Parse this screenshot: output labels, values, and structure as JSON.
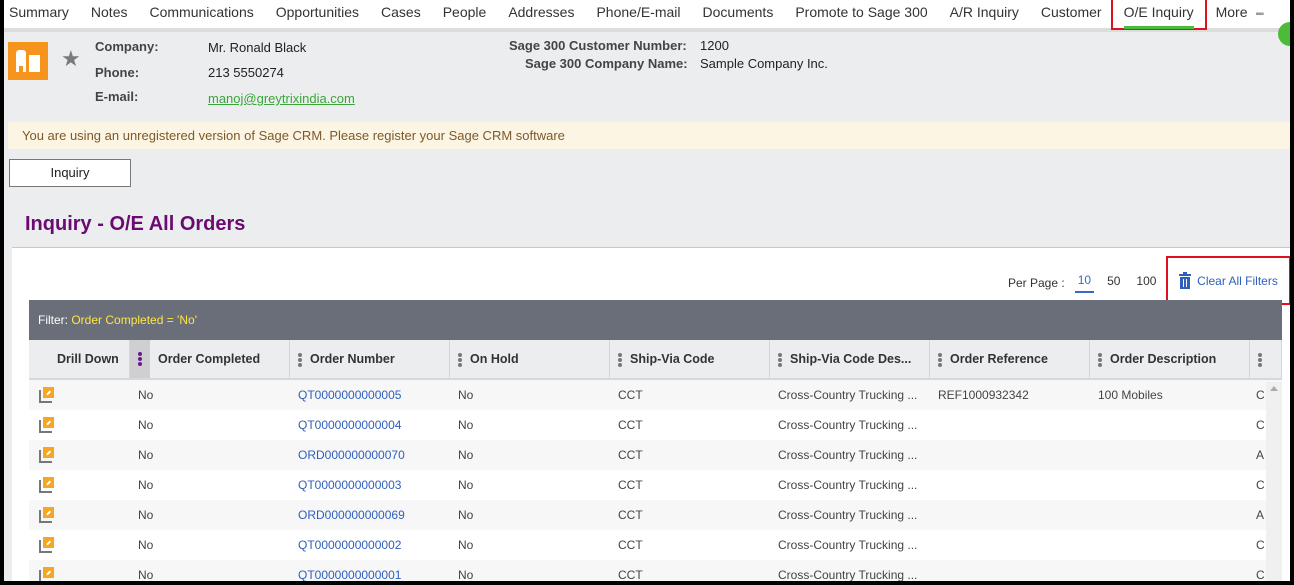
{
  "tabs": [
    {
      "label": "Summary"
    },
    {
      "label": "Notes"
    },
    {
      "label": "Communications"
    },
    {
      "label": "Opportunities"
    },
    {
      "label": "Cases"
    },
    {
      "label": "People"
    },
    {
      "label": "Addresses"
    },
    {
      "label": "Phone/E-mail"
    },
    {
      "label": "Documents"
    },
    {
      "label": "Promote to Sage 300"
    },
    {
      "label": "A/R Inquiry"
    },
    {
      "label": "Customer"
    },
    {
      "label": "O/E Inquiry",
      "active": true
    },
    {
      "label": "More"
    }
  ],
  "more_icon": "ellipsis-icon",
  "entity": {
    "company_label": "Company:",
    "company_value": "Mr. Ronald Black",
    "phone_label": "Phone:",
    "phone_value": "213 5550274",
    "email_label": "E-mail:",
    "email_value": "manoj@greytrixindia.com",
    "cust_num_label": "Sage 300 Customer Number:",
    "cust_num_value": "1200",
    "company_name_label": "Sage 300 Company Name:",
    "company_name_value": "Sample Company Inc."
  },
  "banner": "You are using an unregistered version of Sage CRM. Please register your Sage CRM software",
  "inquiry_button": "Inquiry",
  "page_title": "Inquiry - O/E All Orders",
  "per_page": {
    "label": "Per Page :",
    "options": [
      "10",
      "50",
      "100"
    ],
    "selected": "10"
  },
  "clear_filters": "Clear All Filters",
  "filter": {
    "label": "Filter:",
    "value": "Order Completed = 'No'"
  },
  "columns": [
    "Drill Down",
    "Order Completed",
    "Order Number",
    "On Hold",
    "Ship-Via Code",
    "Ship-Via Code Des...",
    "Order Reference",
    "Order Description",
    ""
  ],
  "rows": [
    {
      "completed": "No",
      "order_number": "QT0000000000005",
      "on_hold": "No",
      "ship_via": "CCT",
      "ship_desc": "Cross-Country Trucking ...",
      "reference": "REF1000932342",
      "description": "100 Mobiles",
      "next": "C"
    },
    {
      "completed": "No",
      "order_number": "QT0000000000004",
      "on_hold": "No",
      "ship_via": "CCT",
      "ship_desc": "Cross-Country Trucking ...",
      "reference": "",
      "description": "",
      "next": "C"
    },
    {
      "completed": "No",
      "order_number": "ORD000000000070",
      "on_hold": "No",
      "ship_via": "CCT",
      "ship_desc": "Cross-Country Trucking ...",
      "reference": "",
      "description": "",
      "next": "A"
    },
    {
      "completed": "No",
      "order_number": "QT0000000000003",
      "on_hold": "No",
      "ship_via": "CCT",
      "ship_desc": "Cross-Country Trucking ...",
      "reference": "",
      "description": "",
      "next": "C"
    },
    {
      "completed": "No",
      "order_number": "ORD000000000069",
      "on_hold": "No",
      "ship_via": "CCT",
      "ship_desc": "Cross-Country Trucking ...",
      "reference": "",
      "description": "",
      "next": "A"
    },
    {
      "completed": "No",
      "order_number": "QT0000000000002",
      "on_hold": "No",
      "ship_via": "CCT",
      "ship_desc": "Cross-Country Trucking ...",
      "reference": "",
      "description": "",
      "next": "C"
    },
    {
      "completed": "No",
      "order_number": "QT0000000000001",
      "on_hold": "No",
      "ship_via": "CCT",
      "ship_desc": "Cross-Country Trucking ...",
      "reference": "",
      "description": "",
      "next": "C"
    }
  ],
  "colors": {
    "accent_green": "#4cbb3a",
    "title_purple": "#6a0a72",
    "link_blue": "#2e5fbf",
    "filter_yellow": "#ffe640",
    "highlight_red": "#e0101e",
    "company_orange": "#f7941d"
  }
}
